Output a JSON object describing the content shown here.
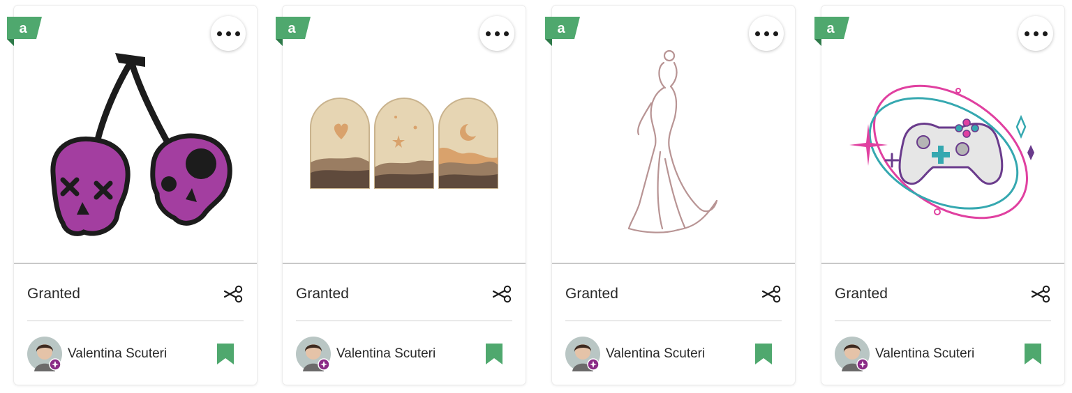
{
  "colors": {
    "brand_green": "#4fa86e",
    "badge_purple": "#8a2a86",
    "divider": "#cfcfcf"
  },
  "cards": [
    {
      "title": "Granted",
      "author": "Valentina Scuteri",
      "artwork": "cherry-skulls",
      "badge_icon": "a-badge-icon",
      "menu_icon": "more-options-icon",
      "action_icon": "scissors-icon",
      "save_icon": "bookmark-icon"
    },
    {
      "title": "Granted",
      "author": "Valentina Scuteri",
      "artwork": "boho-arches",
      "badge_icon": "a-badge-icon",
      "menu_icon": "more-options-icon",
      "action_icon": "scissors-icon",
      "save_icon": "bookmark-icon"
    },
    {
      "title": "Granted",
      "author": "Valentina Scuteri",
      "artwork": "woman-line-art",
      "badge_icon": "a-badge-icon",
      "menu_icon": "more-options-icon",
      "action_icon": "scissors-icon",
      "save_icon": "bookmark-icon"
    },
    {
      "title": "Granted",
      "author": "Valentina Scuteri",
      "artwork": "game-controller",
      "badge_icon": "a-badge-icon",
      "menu_icon": "more-options-icon",
      "action_icon": "scissors-icon",
      "save_icon": "bookmark-icon"
    }
  ]
}
